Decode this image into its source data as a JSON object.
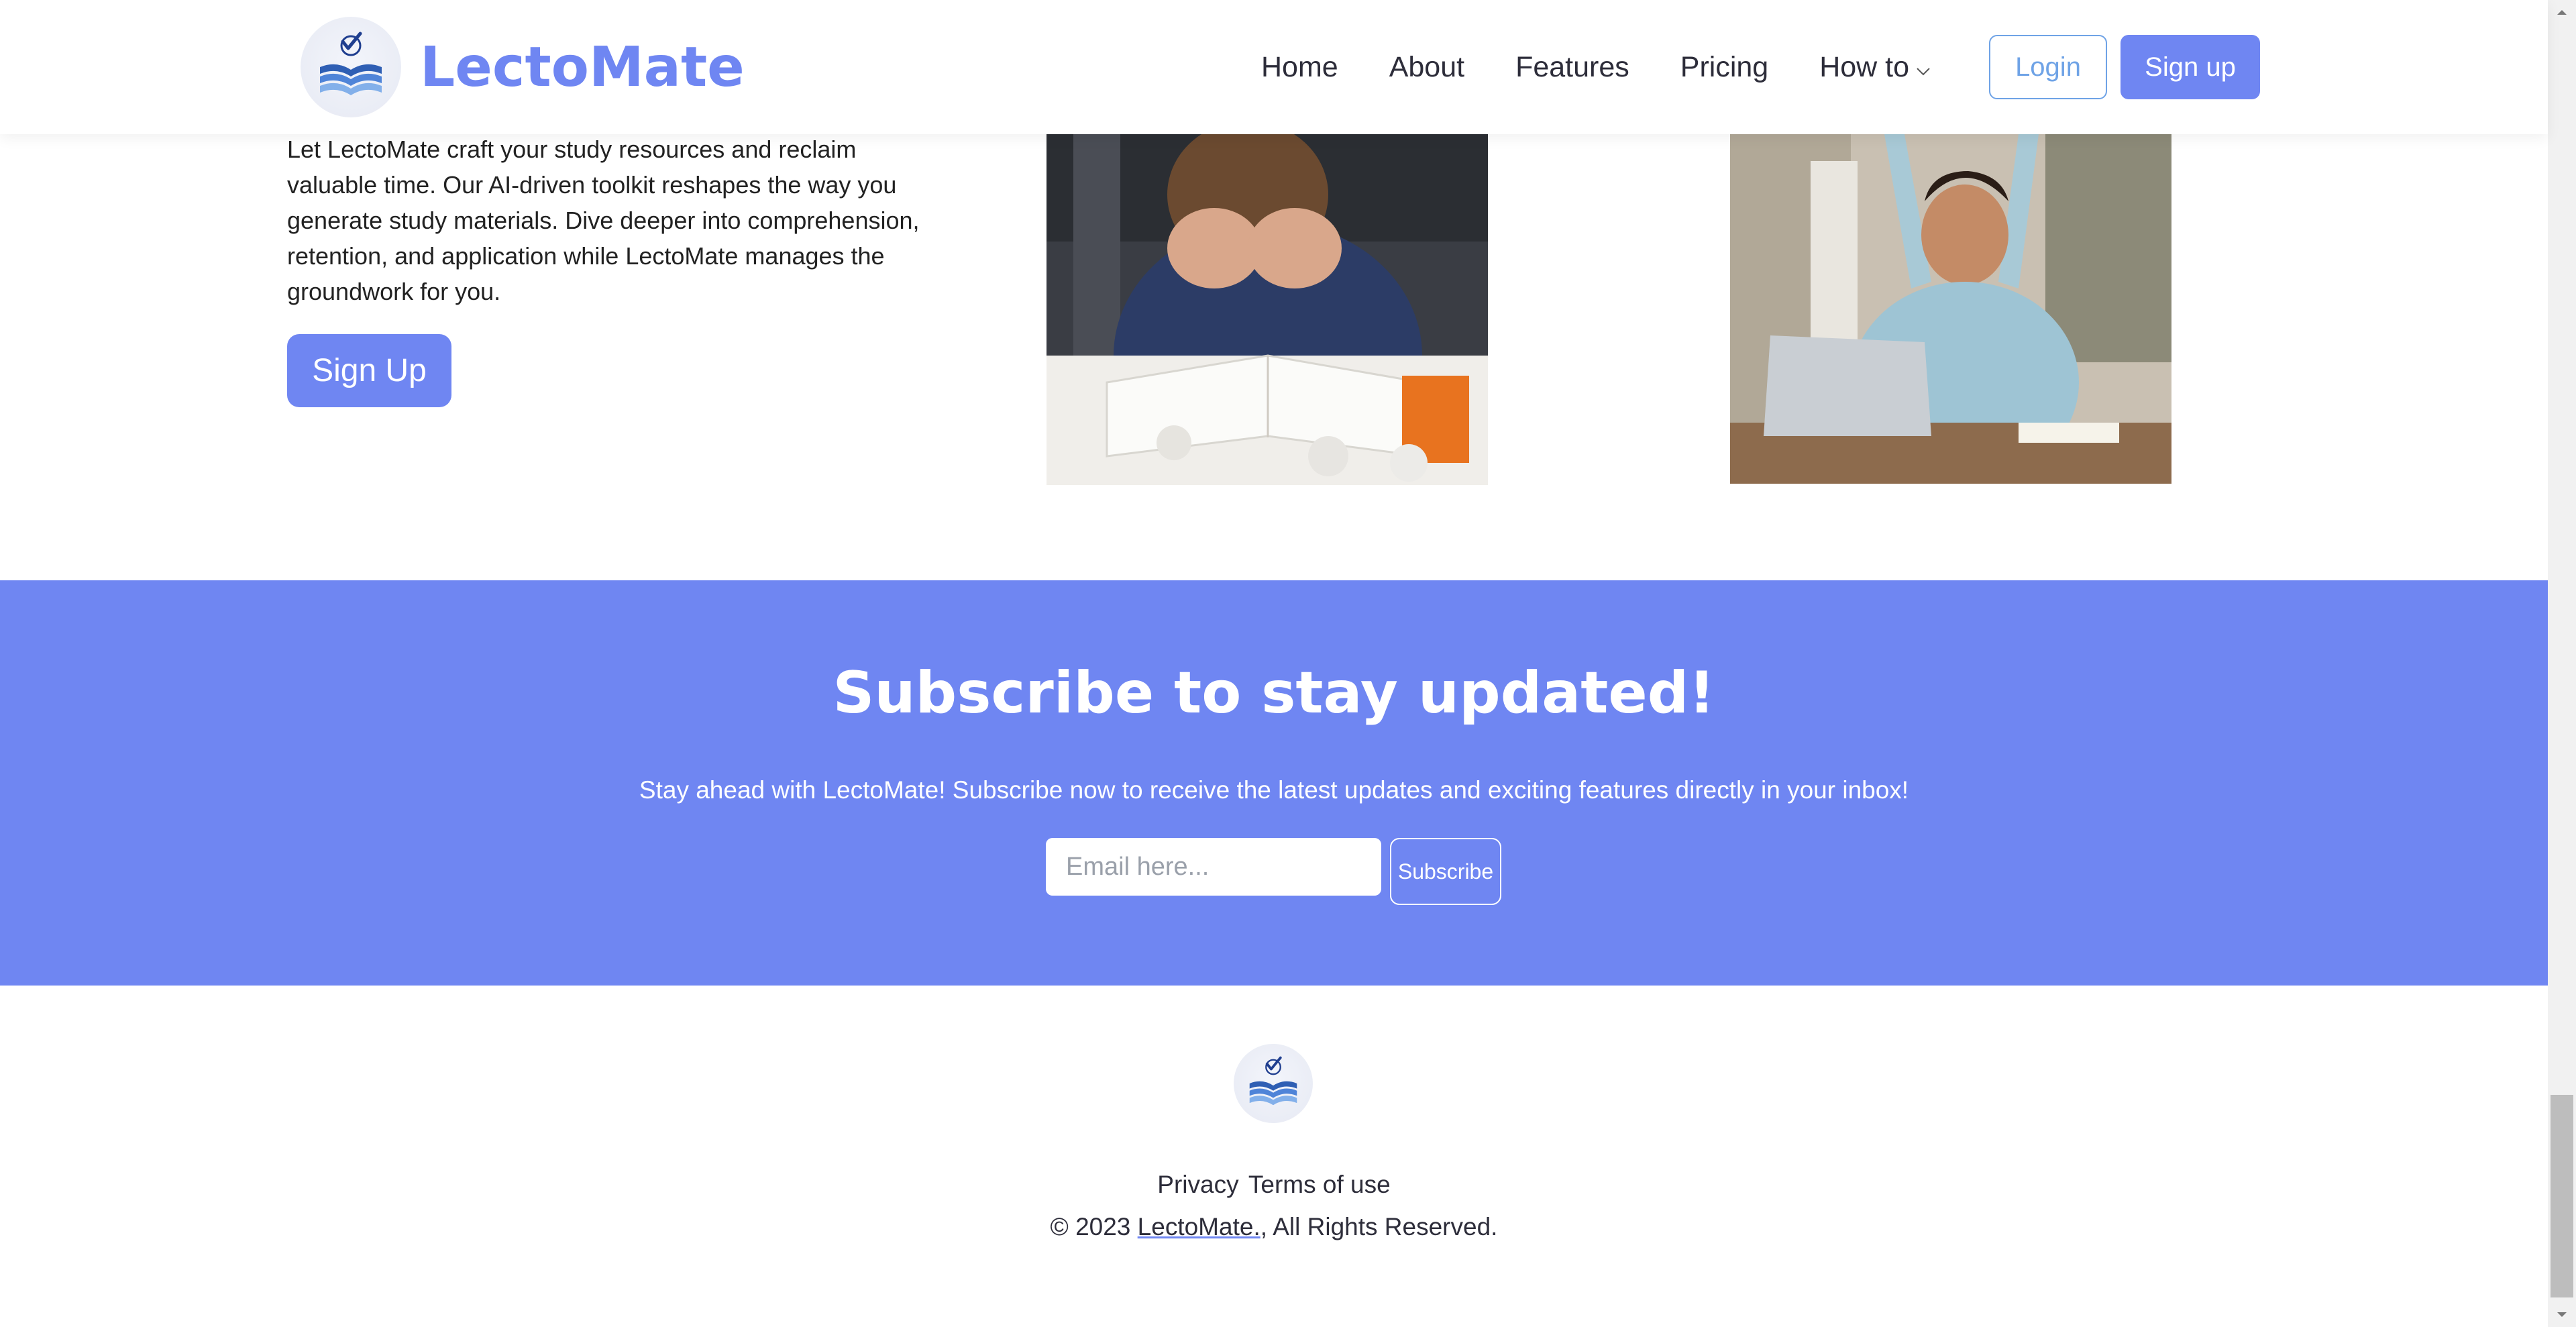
{
  "header": {
    "brand_name": "LectoMate",
    "nav": [
      "Home",
      "About",
      "Features",
      "Pricing",
      "How to"
    ],
    "login_label": "Login",
    "signup_label": "Sign up"
  },
  "hero": {
    "text": "Let LectoMate craft your study resources and reclaim valuable time. Our AI-driven toolkit reshapes the way you generate study materials. Dive deeper into comprehension, retention, and application while LectoMate manages the groundwork for you.",
    "cta_label": "Sign Up"
  },
  "subscribe": {
    "title": "Subscribe to stay updated!",
    "text": "Stay ahead with LectoMate! Subscribe now to receive the latest updates and exciting features directly in your inbox!",
    "email_placeholder": "Email here...",
    "button_label": "Subscribe"
  },
  "footer": {
    "privacy_label": "Privacy",
    "terms_label": "Terms of use",
    "copyright_prefix": "© 2023 ",
    "copyright_link": "LectoMate.",
    "copyright_suffix": ", All Rights Reserved."
  },
  "colors": {
    "accent": "#6f86f2",
    "login_outline": "#6fa3e6",
    "text": "#2d2d3a"
  },
  "icons": {
    "logo": "open-book-checkmark-icon",
    "dropdown": "chevron-down-icon"
  }
}
